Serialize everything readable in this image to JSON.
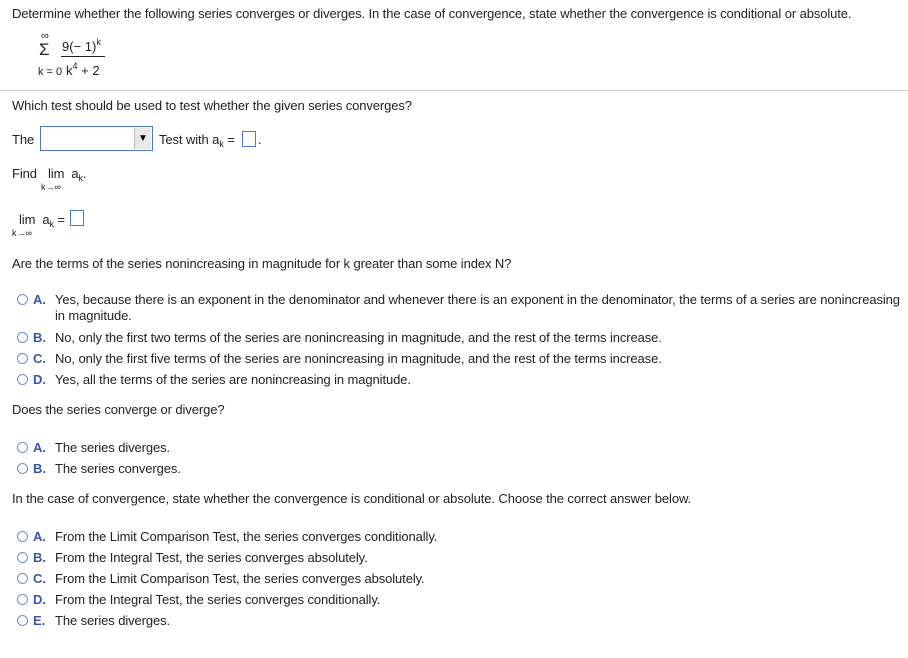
{
  "intro": "Determine whether the following series converges or diverges. In the case of convergence, state whether the convergence is conditional or absolute.",
  "series": {
    "upper": "∞",
    "sigma": "Σ",
    "lower": "k = 0",
    "numerator": "9(− 1)",
    "numerator_exp": "k",
    "denominator_base": "k",
    "denominator_exp": "4",
    "denominator_rest": " + 2"
  },
  "q1": {
    "prompt": "Which test should be used to test whether the given series converges?",
    "prefix": "The",
    "select_value": "",
    "select_arrow": "▼",
    "suffix_a": "Test with a",
    "suffix_sub": "k",
    "suffix_eq": " =",
    "answer_value": "",
    "period": "."
  },
  "q2": {
    "find_label": "Find",
    "lim": "lim",
    "a": "a",
    "sub": "k",
    "period": ".",
    "lim_under": "k→∞",
    "eq": " =",
    "answer_value": ""
  },
  "q3": {
    "prompt": "Are the terms of the series nonincreasing in magnitude for k greater than some index N?",
    "options": [
      {
        "letter": "A.",
        "text": "Yes, because there is an exponent in the denominator and whenever there is an exponent in the denominator, the terms of a series are nonincreasing",
        "text2": "in magnitude."
      },
      {
        "letter": "B.",
        "text": "No, only the first two terms of the series are nonincreasing in magnitude, and the rest of the terms increase."
      },
      {
        "letter": "C.",
        "text": "No, only the first five terms of the series are nonincreasing in magnitude, and the rest of the terms increase."
      },
      {
        "letter": "D.",
        "text": "Yes, all the terms of the series are nonincreasing in magnitude."
      }
    ]
  },
  "q4": {
    "prompt": "Does the series converge or diverge?",
    "options": [
      {
        "letter": "A.",
        "text": "The series diverges."
      },
      {
        "letter": "B.",
        "text": "The series converges."
      }
    ]
  },
  "q5": {
    "prompt": "In the case of convergence, state whether the convergence is conditional or absolute. Choose the correct answer below.",
    "options": [
      {
        "letter": "A.",
        "text": "From the Limit Comparison Test, the series converges conditionally."
      },
      {
        "letter": "B.",
        "text": "From the Integral Test, the series converges absolutely."
      },
      {
        "letter": "C.",
        "text": "From the Limit Comparison Test, the series converges absolutely."
      },
      {
        "letter": "D.",
        "text": "From the Integral Test, the series converges conditionally."
      },
      {
        "letter": "E.",
        "text": "The series diverges."
      }
    ]
  }
}
